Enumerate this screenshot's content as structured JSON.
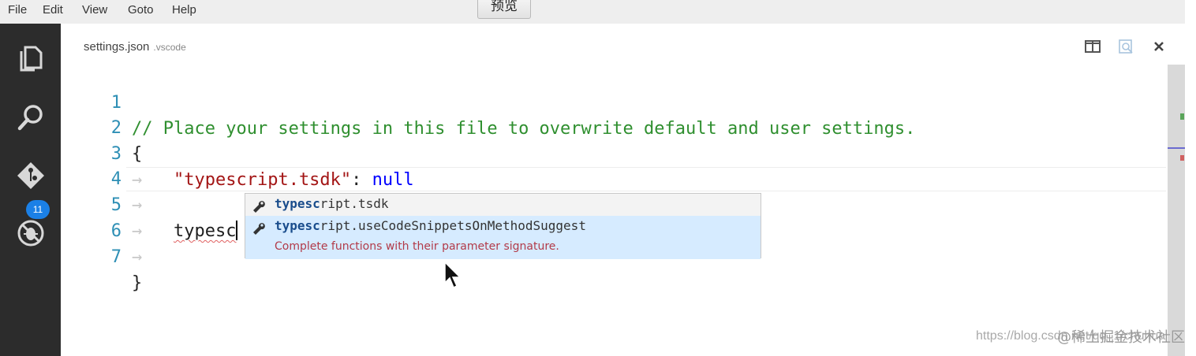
{
  "menu": {
    "items": [
      "File",
      "Edit",
      "View",
      "Goto",
      "Help"
    ],
    "preview_button": "预览"
  },
  "activity_bar": {
    "icons": [
      "explorer-icon",
      "search-icon",
      "git-icon",
      "debug-icon"
    ],
    "git_badge": "11"
  },
  "tab": {
    "filename": "settings.json",
    "folder": ".vscode",
    "actions": [
      "split-editor-icon",
      "open-preview-icon",
      "close-icon"
    ]
  },
  "editor": {
    "lines": [
      {
        "number": "1",
        "comment": "// Place your settings in this file to overwrite default and user settings."
      },
      {
        "number": "2",
        "text": "{"
      },
      {
        "number": "3",
        "key": "\"typescript.tsdk\"",
        "colon": ": ",
        "value": "null"
      },
      {
        "number": "4"
      },
      {
        "number": "5",
        "typed": "typesc"
      },
      {
        "number": "6"
      },
      {
        "number": "7",
        "text": "}"
      }
    ],
    "whitespace_glyph": "→"
  },
  "suggestions": {
    "items": [
      {
        "match": "typesc",
        "rest": "ript.tsdk",
        "icon": "wrench-icon"
      },
      {
        "match": "typesc",
        "rest": "ript.useCodeSnippetsOnMethodSuggest",
        "icon": "wrench-icon",
        "detail": "Complete functions with their parameter signature."
      }
    ]
  },
  "watermark": {
    "url": "https://blog.csdn.net/qq_1/chuhua",
    "text": "@稀土掘金技术社区"
  },
  "colors": {
    "activity_bar": "#2c2c2c",
    "badge": "#1b80e6",
    "comment": "#2f8f2f",
    "string": "#a31515",
    "keyword": "#0000ff",
    "line_number": "#2e8fb5",
    "suggest_selected": "#d6ebff",
    "suggest_detail": "#b23a48"
  }
}
